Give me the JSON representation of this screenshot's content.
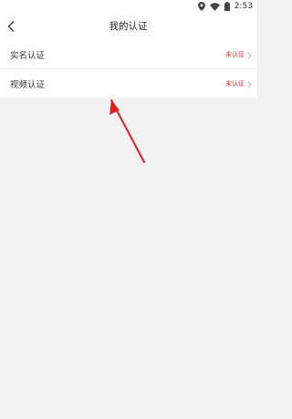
{
  "status_bar": {
    "time": "2:53",
    "icons": [
      "location-icon",
      "wifi-icon",
      "battery-icon"
    ]
  },
  "header": {
    "title": "我的认证",
    "back_icon": "chevron-left-icon"
  },
  "list": {
    "items": [
      {
        "label": "实名认证",
        "status": "未认证",
        "chevron": "chevron-right-icon"
      },
      {
        "label": "视频认证",
        "status": "未认证",
        "chevron": "chevron-right-icon"
      }
    ]
  },
  "annotation": {
    "icon": "red-arrow-icon",
    "color": "#e02020"
  },
  "colors": {
    "page_background": "#f2f2f2",
    "surface": "#ffffff",
    "status_text": "#e53935"
  }
}
